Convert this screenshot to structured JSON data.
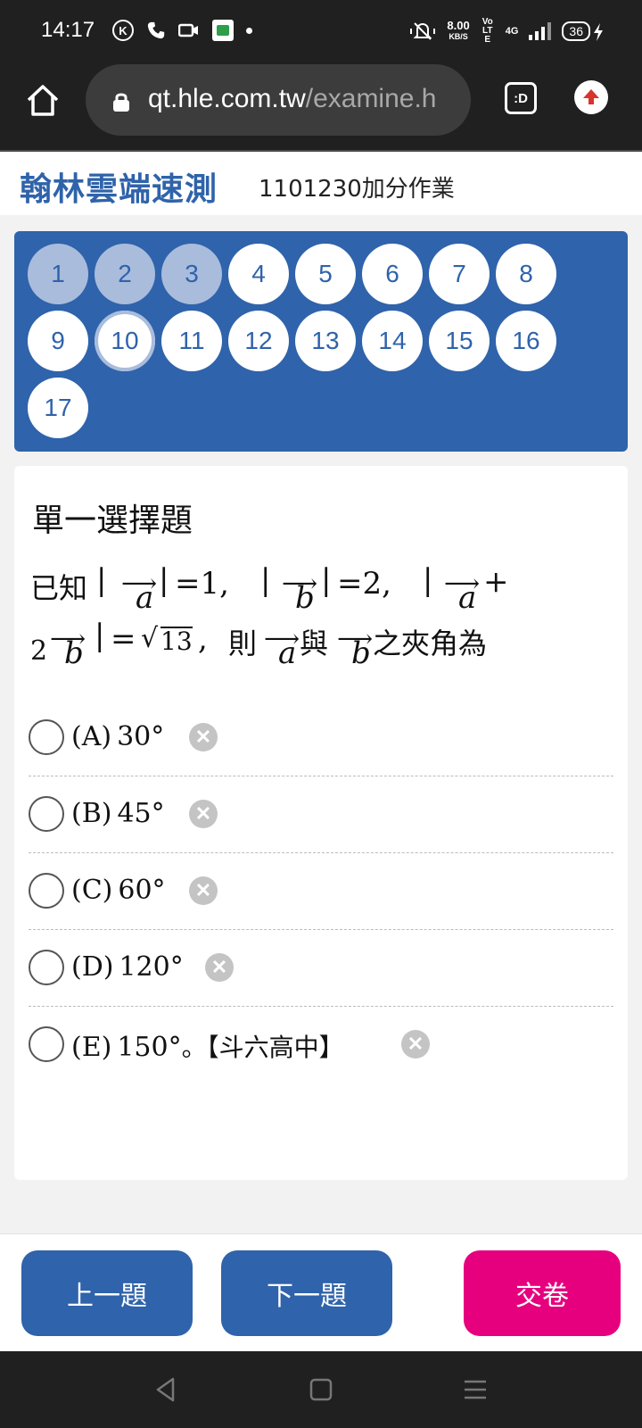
{
  "status_bar": {
    "time": "14:17",
    "net_speed": "8.00",
    "net_unit": "KB/S",
    "volte": "Vo LTE",
    "network": "4G",
    "battery": "36"
  },
  "browser": {
    "url_host": "qt.hle.com.tw",
    "url_path": "/examine.h",
    "tab_label": ":D"
  },
  "header": {
    "logo": "翰林雲端速測",
    "exam_title": "1101230加分作業"
  },
  "question_nav": {
    "items": [
      {
        "label": "1",
        "state": "done"
      },
      {
        "label": "2",
        "state": "done"
      },
      {
        "label": "3",
        "state": "done"
      },
      {
        "label": "4",
        "state": "todo"
      },
      {
        "label": "5",
        "state": "todo"
      },
      {
        "label": "6",
        "state": "todo"
      },
      {
        "label": "7",
        "state": "todo"
      },
      {
        "label": "8",
        "state": "todo"
      },
      {
        "label": "9",
        "state": "todo"
      },
      {
        "label": "10",
        "state": "current"
      },
      {
        "label": "11",
        "state": "todo"
      },
      {
        "label": "12",
        "state": "todo"
      },
      {
        "label": "13",
        "state": "todo"
      },
      {
        "label": "14",
        "state": "todo"
      },
      {
        "label": "15",
        "state": "todo"
      },
      {
        "label": "16",
        "state": "todo"
      },
      {
        "label": "17",
        "state": "todo"
      }
    ]
  },
  "question": {
    "type": "單一選擇題",
    "stem": {
      "known": "已知",
      "bar": "|",
      "vec_a": "a",
      "vec_b": "b",
      "arrow": "⟶",
      "eq1": "=1,",
      "eq2": "=2,",
      "plus": "+",
      "two": "2",
      "eq3": "=",
      "sqrt_val": "13",
      "sqrt_sign": "√",
      "then_comma": ",",
      "then": "則",
      "and": "與",
      "angle": "之夾角為"
    },
    "options": [
      {
        "label": "(A)",
        "text": "30°",
        "suffix": ""
      },
      {
        "label": "(B)",
        "text": "45°",
        "suffix": ""
      },
      {
        "label": "(C)",
        "text": "60°",
        "suffix": ""
      },
      {
        "label": "(D)",
        "text": "120°",
        "suffix": ""
      },
      {
        "label": "(E)",
        "text": "150°",
        "suffix": "。【斗六高中】"
      }
    ],
    "clear_symbol": "✕"
  },
  "actions": {
    "prev": "上一題",
    "next": "下一題",
    "submit": "交卷"
  },
  "colors": {
    "primary": "#2f63ab",
    "answered": "#a9bcdc",
    "submit": "#e6007e",
    "chrome": "#202020"
  }
}
